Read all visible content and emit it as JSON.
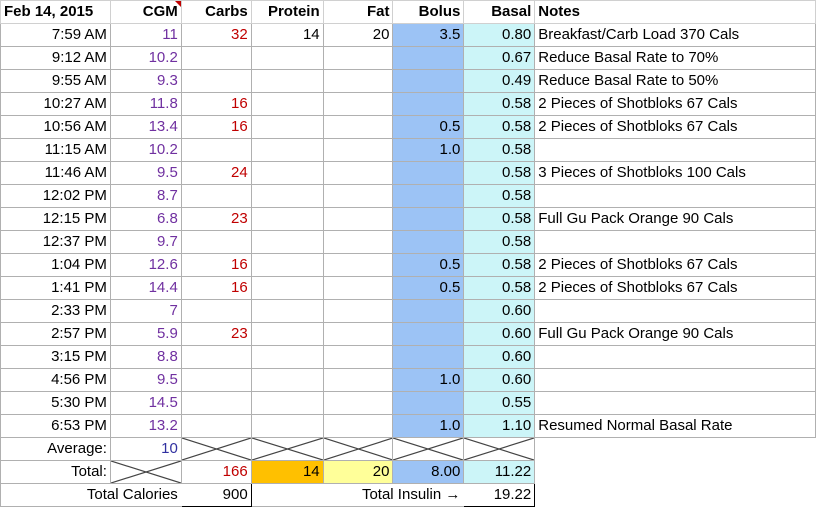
{
  "header": {
    "date": "Feb 14, 2015",
    "cgm": "CGM",
    "carbs": "Carbs",
    "protein": "Protein",
    "fat": "Fat",
    "bolus": "Bolus",
    "basal": "Basal",
    "notes": "Notes"
  },
  "rows": [
    {
      "time": "7:59 AM",
      "cgm": "11",
      "carbs": "32",
      "protein": "14",
      "fat": "20",
      "bolus": "3.5",
      "basal": "0.80",
      "notes": "Breakfast/Carb Load 370 Cals"
    },
    {
      "time": "9:12 AM",
      "cgm": "10.2",
      "carbs": "",
      "protein": "",
      "fat": "",
      "bolus": "",
      "basal": "0.67",
      "notes": "Reduce Basal Rate to 70%"
    },
    {
      "time": "9:55 AM",
      "cgm": "9.3",
      "carbs": "",
      "protein": "",
      "fat": "",
      "bolus": "",
      "basal": "0.49",
      "notes": "Reduce Basal Rate to 50%"
    },
    {
      "time": "10:27 AM",
      "cgm": "11.8",
      "carbs": "16",
      "protein": "",
      "fat": "",
      "bolus": "",
      "basal": "0.58",
      "notes": "2 Pieces of Shotbloks 67 Cals"
    },
    {
      "time": "10:56 AM",
      "cgm": "13.4",
      "carbs": "16",
      "protein": "",
      "fat": "",
      "bolus": "0.5",
      "basal": "0.58",
      "notes": "2 Pieces of Shotbloks 67 Cals"
    },
    {
      "time": "11:15 AM",
      "cgm": "10.2",
      "carbs": "",
      "protein": "",
      "fat": "",
      "bolus": "1.0",
      "basal": "0.58",
      "notes": ""
    },
    {
      "time": "11:46 AM",
      "cgm": "9.5",
      "carbs": "24",
      "protein": "",
      "fat": "",
      "bolus": "",
      "basal": "0.58",
      "notes": "3 Pieces of Shotbloks 100 Cals"
    },
    {
      "time": "12:02 PM",
      "cgm": "8.7",
      "carbs": "",
      "protein": "",
      "fat": "",
      "bolus": "",
      "basal": "0.58",
      "notes": ""
    },
    {
      "time": "12:15 PM",
      "cgm": "6.8",
      "carbs": "23",
      "protein": "",
      "fat": "",
      "bolus": "",
      "basal": "0.58",
      "notes": "Full Gu Pack Orange 90 Cals"
    },
    {
      "time": "12:37 PM",
      "cgm": "9.7",
      "carbs": "",
      "protein": "",
      "fat": "",
      "bolus": "",
      "basal": "0.58",
      "notes": ""
    },
    {
      "time": "1:04 PM",
      "cgm": "12.6",
      "carbs": "16",
      "protein": "",
      "fat": "",
      "bolus": "0.5",
      "basal": "0.58",
      "notes": "2 Pieces of Shotbloks 67 Cals"
    },
    {
      "time": "1:41 PM",
      "cgm": "14.4",
      "carbs": "16",
      "protein": "",
      "fat": "",
      "bolus": "0.5",
      "basal": "0.58",
      "notes": "2 Pieces of Shotbloks 67 Cals"
    },
    {
      "time": "2:33 PM",
      "cgm": "7",
      "carbs": "",
      "protein": "",
      "fat": "",
      "bolus": "",
      "basal": "0.60",
      "notes": ""
    },
    {
      "time": "2:57 PM",
      "cgm": "5.9",
      "carbs": "23",
      "protein": "",
      "fat": "",
      "bolus": "",
      "basal": "0.60",
      "notes": "Full Gu Pack Orange 90 Cals"
    },
    {
      "time": "3:15 PM",
      "cgm": "8.8",
      "carbs": "",
      "protein": "",
      "fat": "",
      "bolus": "",
      "basal": "0.60",
      "notes": ""
    },
    {
      "time": "4:56 PM",
      "cgm": "9.5",
      "carbs": "",
      "protein": "",
      "fat": "",
      "bolus": "1.0",
      "basal": "0.60",
      "notes": ""
    },
    {
      "time": "5:30 PM",
      "cgm": "14.5",
      "carbs": "",
      "protein": "",
      "fat": "",
      "bolus": "",
      "basal": "0.55",
      "notes": ""
    },
    {
      "time": "6:53 PM",
      "cgm": "13.2",
      "carbs": "",
      "protein": "",
      "fat": "",
      "bolus": "1.0",
      "basal": "1.10",
      "notes": "Resumed Normal Basal Rate"
    }
  ],
  "average": {
    "label": "Average:",
    "cgm": "10"
  },
  "totals": {
    "label": "Total:",
    "carbs": "166",
    "protein": "14",
    "fat": "20",
    "bolus": "8.00",
    "basal": "11.22"
  },
  "summary": {
    "calories_label": "Total Calories",
    "calories": "900",
    "insulin_label": "Total Insulin →",
    "insulin": "19.22"
  },
  "colors": {
    "cgm": "#7030a0",
    "carbs": "#c00000",
    "bolus_fill": "#9cc3f5",
    "basal_fill": "#ccf5f8",
    "protein_total_fill": "#ffc000",
    "fat_total_fill": "#ffff99"
  }
}
